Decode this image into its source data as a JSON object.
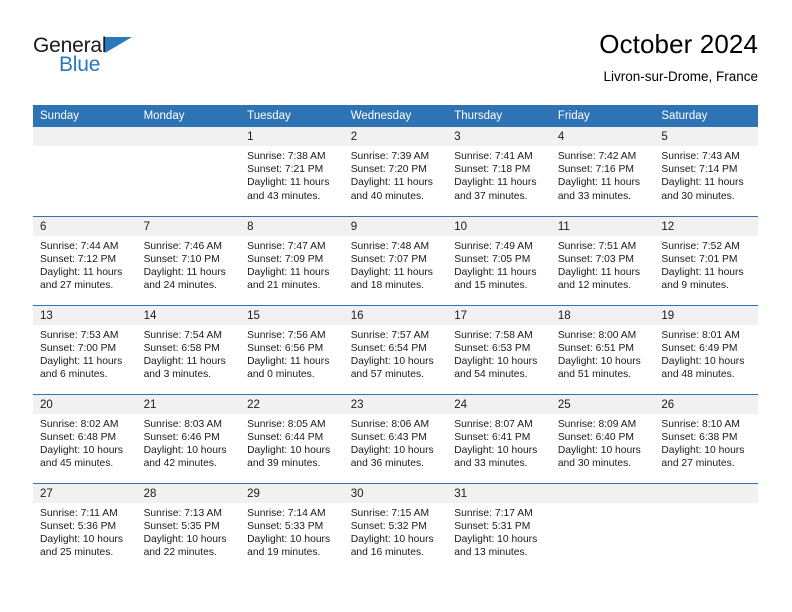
{
  "brand": {
    "name_top": "General",
    "name_bottom": "Blue",
    "accent_color": "#2b79bd"
  },
  "header": {
    "title": "October 2024",
    "location": "Livron-sur-Drome, France"
  },
  "theme": {
    "header_blue": "#2e74b5",
    "daystrip_grey": "#f1f1f1",
    "text": "#1a1a1a"
  },
  "weekday_headers": [
    "Sunday",
    "Monday",
    "Tuesday",
    "Wednesday",
    "Thursday",
    "Friday",
    "Saturday"
  ],
  "labels": {
    "sunrise_prefix": "Sunrise:",
    "sunset_prefix": "Sunset:",
    "daylight_prefix": "Daylight:"
  },
  "weeks": [
    [
      {
        "day": ""
      },
      {
        "day": ""
      },
      {
        "day": "1",
        "sunrise": "Sunrise: 7:38 AM",
        "sunset": "Sunset: 7:21 PM",
        "daylight_line1": "Daylight: 11 hours",
        "daylight_line2": "and 43 minutes."
      },
      {
        "day": "2",
        "sunrise": "Sunrise: 7:39 AM",
        "sunset": "Sunset: 7:20 PM",
        "daylight_line1": "Daylight: 11 hours",
        "daylight_line2": "and 40 minutes."
      },
      {
        "day": "3",
        "sunrise": "Sunrise: 7:41 AM",
        "sunset": "Sunset: 7:18 PM",
        "daylight_line1": "Daylight: 11 hours",
        "daylight_line2": "and 37 minutes."
      },
      {
        "day": "4",
        "sunrise": "Sunrise: 7:42 AM",
        "sunset": "Sunset: 7:16 PM",
        "daylight_line1": "Daylight: 11 hours",
        "daylight_line2": "and 33 minutes."
      },
      {
        "day": "5",
        "sunrise": "Sunrise: 7:43 AM",
        "sunset": "Sunset: 7:14 PM",
        "daylight_line1": "Daylight: 11 hours",
        "daylight_line2": "and 30 minutes."
      }
    ],
    [
      {
        "day": "6",
        "sunrise": "Sunrise: 7:44 AM",
        "sunset": "Sunset: 7:12 PM",
        "daylight_line1": "Daylight: 11 hours",
        "daylight_line2": "and 27 minutes."
      },
      {
        "day": "7",
        "sunrise": "Sunrise: 7:46 AM",
        "sunset": "Sunset: 7:10 PM",
        "daylight_line1": "Daylight: 11 hours",
        "daylight_line2": "and 24 minutes."
      },
      {
        "day": "8",
        "sunrise": "Sunrise: 7:47 AM",
        "sunset": "Sunset: 7:09 PM",
        "daylight_line1": "Daylight: 11 hours",
        "daylight_line2": "and 21 minutes."
      },
      {
        "day": "9",
        "sunrise": "Sunrise: 7:48 AM",
        "sunset": "Sunset: 7:07 PM",
        "daylight_line1": "Daylight: 11 hours",
        "daylight_line2": "and 18 minutes."
      },
      {
        "day": "10",
        "sunrise": "Sunrise: 7:49 AM",
        "sunset": "Sunset: 7:05 PM",
        "daylight_line1": "Daylight: 11 hours",
        "daylight_line2": "and 15 minutes."
      },
      {
        "day": "11",
        "sunrise": "Sunrise: 7:51 AM",
        "sunset": "Sunset: 7:03 PM",
        "daylight_line1": "Daylight: 11 hours",
        "daylight_line2": "and 12 minutes."
      },
      {
        "day": "12",
        "sunrise": "Sunrise: 7:52 AM",
        "sunset": "Sunset: 7:01 PM",
        "daylight_line1": "Daylight: 11 hours",
        "daylight_line2": "and 9 minutes."
      }
    ],
    [
      {
        "day": "13",
        "sunrise": "Sunrise: 7:53 AM",
        "sunset": "Sunset: 7:00 PM",
        "daylight_line1": "Daylight: 11 hours",
        "daylight_line2": "and 6 minutes."
      },
      {
        "day": "14",
        "sunrise": "Sunrise: 7:54 AM",
        "sunset": "Sunset: 6:58 PM",
        "daylight_line1": "Daylight: 11 hours",
        "daylight_line2": "and 3 minutes."
      },
      {
        "day": "15",
        "sunrise": "Sunrise: 7:56 AM",
        "sunset": "Sunset: 6:56 PM",
        "daylight_line1": "Daylight: 11 hours",
        "daylight_line2": "and 0 minutes."
      },
      {
        "day": "16",
        "sunrise": "Sunrise: 7:57 AM",
        "sunset": "Sunset: 6:54 PM",
        "daylight_line1": "Daylight: 10 hours",
        "daylight_line2": "and 57 minutes."
      },
      {
        "day": "17",
        "sunrise": "Sunrise: 7:58 AM",
        "sunset": "Sunset: 6:53 PM",
        "daylight_line1": "Daylight: 10 hours",
        "daylight_line2": "and 54 minutes."
      },
      {
        "day": "18",
        "sunrise": "Sunrise: 8:00 AM",
        "sunset": "Sunset: 6:51 PM",
        "daylight_line1": "Daylight: 10 hours",
        "daylight_line2": "and 51 minutes."
      },
      {
        "day": "19",
        "sunrise": "Sunrise: 8:01 AM",
        "sunset": "Sunset: 6:49 PM",
        "daylight_line1": "Daylight: 10 hours",
        "daylight_line2": "and 48 minutes."
      }
    ],
    [
      {
        "day": "20",
        "sunrise": "Sunrise: 8:02 AM",
        "sunset": "Sunset: 6:48 PM",
        "daylight_line1": "Daylight: 10 hours",
        "daylight_line2": "and 45 minutes."
      },
      {
        "day": "21",
        "sunrise": "Sunrise: 8:03 AM",
        "sunset": "Sunset: 6:46 PM",
        "daylight_line1": "Daylight: 10 hours",
        "daylight_line2": "and 42 minutes."
      },
      {
        "day": "22",
        "sunrise": "Sunrise: 8:05 AM",
        "sunset": "Sunset: 6:44 PM",
        "daylight_line1": "Daylight: 10 hours",
        "daylight_line2": "and 39 minutes."
      },
      {
        "day": "23",
        "sunrise": "Sunrise: 8:06 AM",
        "sunset": "Sunset: 6:43 PM",
        "daylight_line1": "Daylight: 10 hours",
        "daylight_line2": "and 36 minutes."
      },
      {
        "day": "24",
        "sunrise": "Sunrise: 8:07 AM",
        "sunset": "Sunset: 6:41 PM",
        "daylight_line1": "Daylight: 10 hours",
        "daylight_line2": "and 33 minutes."
      },
      {
        "day": "25",
        "sunrise": "Sunrise: 8:09 AM",
        "sunset": "Sunset: 6:40 PM",
        "daylight_line1": "Daylight: 10 hours",
        "daylight_line2": "and 30 minutes."
      },
      {
        "day": "26",
        "sunrise": "Sunrise: 8:10 AM",
        "sunset": "Sunset: 6:38 PM",
        "daylight_line1": "Daylight: 10 hours",
        "daylight_line2": "and 27 minutes."
      }
    ],
    [
      {
        "day": "27",
        "sunrise": "Sunrise: 7:11 AM",
        "sunset": "Sunset: 5:36 PM",
        "daylight_line1": "Daylight: 10 hours",
        "daylight_line2": "and 25 minutes."
      },
      {
        "day": "28",
        "sunrise": "Sunrise: 7:13 AM",
        "sunset": "Sunset: 5:35 PM",
        "daylight_line1": "Daylight: 10 hours",
        "daylight_line2": "and 22 minutes."
      },
      {
        "day": "29",
        "sunrise": "Sunrise: 7:14 AM",
        "sunset": "Sunset: 5:33 PM",
        "daylight_line1": "Daylight: 10 hours",
        "daylight_line2": "and 19 minutes."
      },
      {
        "day": "30",
        "sunrise": "Sunrise: 7:15 AM",
        "sunset": "Sunset: 5:32 PM",
        "daylight_line1": "Daylight: 10 hours",
        "daylight_line2": "and 16 minutes."
      },
      {
        "day": "31",
        "sunrise": "Sunrise: 7:17 AM",
        "sunset": "Sunset: 5:31 PM",
        "daylight_line1": "Daylight: 10 hours",
        "daylight_line2": "and 13 minutes."
      },
      {
        "day": ""
      },
      {
        "day": ""
      }
    ]
  ]
}
